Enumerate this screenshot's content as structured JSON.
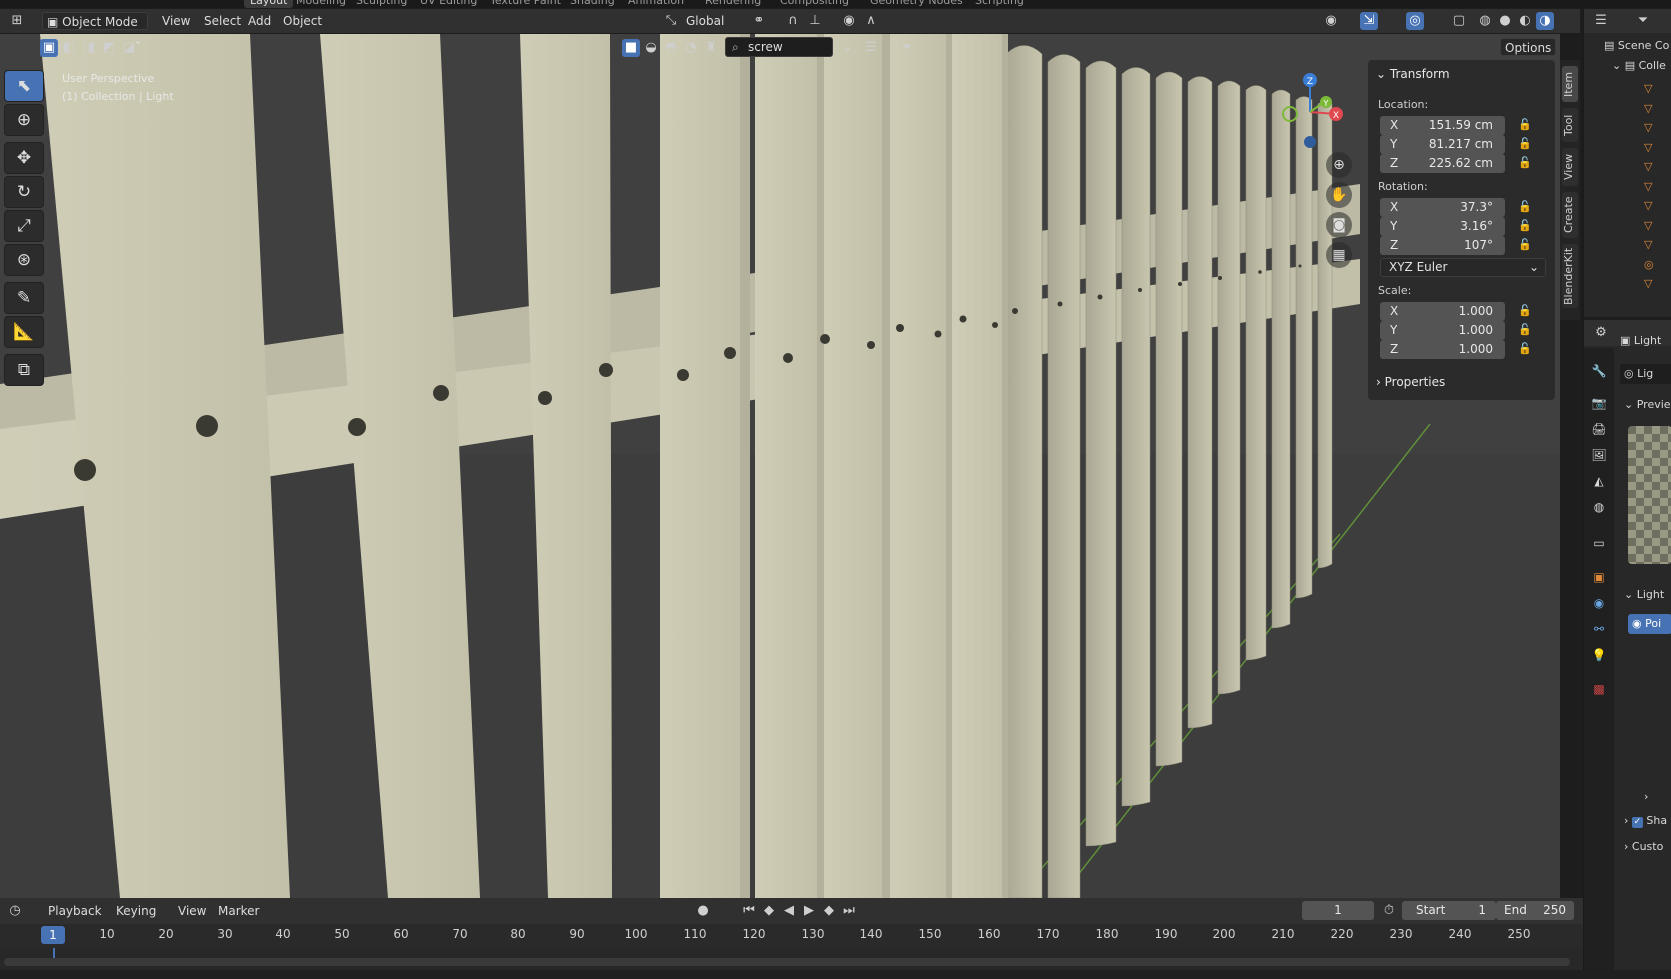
{
  "workspace_tabs": [
    "Layout",
    "Modeling",
    "Sculpting",
    "UV Editing",
    "Texture Paint",
    "Shading",
    "Animation",
    "Rendering",
    "Compositing",
    "Geometry Nodes",
    "Scripting"
  ],
  "header": {
    "mode": "Object Mode",
    "menus": [
      "View",
      "Select",
      "Add",
      "Object"
    ],
    "orientation": "Global"
  },
  "subbar": {
    "search_value": "screw",
    "options_label": "Options"
  },
  "viewport": {
    "perspective": "User Perspective",
    "context": "(1) Collection | Light"
  },
  "gizmo": {
    "x": "X",
    "y": "Y",
    "z": "Z"
  },
  "npanel": {
    "transform_title": "Transform",
    "location_label": "Location:",
    "location": [
      {
        "axis": "X",
        "value": "151.59 cm"
      },
      {
        "axis": "Y",
        "value": "81.217 cm"
      },
      {
        "axis": "Z",
        "value": "225.62 cm"
      }
    ],
    "rotation_label": "Rotation:",
    "rotation": [
      {
        "axis": "X",
        "value": "37.3°"
      },
      {
        "axis": "Y",
        "value": "3.16°"
      },
      {
        "axis": "Z",
        "value": "107°"
      }
    ],
    "rotation_mode": "XYZ Euler",
    "scale_label": "Scale:",
    "scale": [
      {
        "axis": "X",
        "value": "1.000"
      },
      {
        "axis": "Y",
        "value": "1.000"
      },
      {
        "axis": "Z",
        "value": "1.000"
      }
    ],
    "properties_title": "Properties"
  },
  "panel_tabs": [
    "Item",
    "Tool",
    "View",
    "Create",
    "BlenderKit"
  ],
  "outliner": {
    "scene_collection": "Scene Co",
    "collection": "Colle"
  },
  "properties": {
    "object_name": "Light",
    "data_name": "Lig",
    "preview_label": "Previe",
    "light_section": "Light",
    "light_type": "Poi",
    "shadow_label": "Sha",
    "custom_label": "Custo"
  },
  "timeline": {
    "menus": [
      "Playback",
      "Keying",
      "View",
      "Marker"
    ],
    "current_frame": "1",
    "start_label": "Start",
    "start_value": "1",
    "end_label": "End",
    "end_value": "250",
    "ruler_current": "1",
    "ruler_ticks": [
      "10",
      "20",
      "30",
      "40",
      "50",
      "60",
      "70",
      "80",
      "90",
      "100",
      "110",
      "120",
      "130",
      "140",
      "150",
      "160",
      "170",
      "180",
      "190",
      "200",
      "210",
      "220",
      "230",
      "240",
      "250"
    ]
  },
  "colors": {
    "accent": "#4772b3",
    "wood": "#c9c8b0",
    "ground": "#3e3e3e",
    "x_axis": "#e0484f",
    "y_axis": "#7dba3a",
    "z_axis": "#3a7dd6"
  }
}
